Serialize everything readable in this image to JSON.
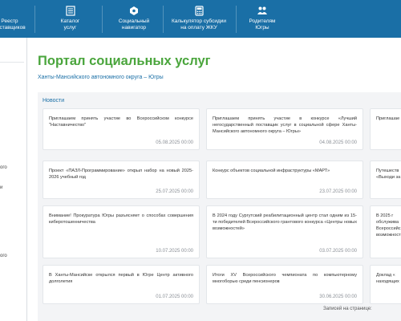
{
  "nav": {
    "items": [
      {
        "label": "Реестр\nпоставщиков",
        "icon": "list-icon"
      },
      {
        "label": "Каталог\nуслуг",
        "icon": "catalog-icon"
      },
      {
        "label": "Социальный\nнавигатор",
        "icon": "navigator-icon"
      },
      {
        "label": "Калькулятор субсидии\nна оплату ЖКУ",
        "icon": "calculator-icon"
      },
      {
        "label": "Родителям\nЮгры",
        "icon": "parents-icon"
      }
    ]
  },
  "sidebar": {
    "items": [
      "ого",
      "и",
      "ого"
    ]
  },
  "page": {
    "title": "Портал социальных услуг",
    "subtitle": "Ханты-Мансийского автономного округа – Югры"
  },
  "news": {
    "heading": "Новости",
    "cards": [
      {
        "text": "Приглашаем принять участие во Всероссийском конкурсе \"Наставничество\"",
        "date": "05.08.2025 00:00"
      },
      {
        "text": "Приглашаем принять участие в конкурсе «Лучший негосударственный поставщик услуг в социальной сфере Ханты-Мансийского автономного округа – Югры»",
        "date": "04.08.2025 00:00"
      },
      {
        "text": "Приглашае",
        "date": ""
      },
      {
        "text": "Проект «ПАЗЛ-Программирование» открыл набор на новый 2025-2026 учебный год",
        "date": "25.07.2025 00:00"
      },
      {
        "text": "Конкурс объектов социальной инфраструктуры «МАРТ»",
        "date": "23.07.2025 00:00"
      },
      {
        "text": "Путешеств «Выходи за",
        "date": ""
      },
      {
        "text": "Внимание! Прокуратура Югры разъясняет о способах совершения киберотошенничества",
        "date": "10.07.2025 00:00"
      },
      {
        "text": "В 2024 году Сургутский реабилитационный центр стал одним из 15-ти победителей Всероссийского грантового конкурса «Центры новых возможностей»",
        "date": "03.07.2025 00:00"
      },
      {
        "text": "В 2025 г обслужива Всероссийс возможност",
        "date": ""
      },
      {
        "text": "В Ханты-Мансийске открылся первый в Югре Центр активного долголетия",
        "date": "01.07.2025 00:00"
      },
      {
        "text": "Итоги XV Всероссийского чемпионата по компьютерному многоборью среди пенсионеров",
        "date": "30.06.2025 00:00"
      },
      {
        "text": "Доклад « находящих",
        "date": ""
      }
    ]
  },
  "footer": {
    "per_page_label": "Записей на странице:"
  },
  "colors": {
    "nav_bg": "#1a6fa6",
    "title_green": "#4aa53c",
    "link_blue": "#1a6fa6",
    "news_bg": "#f3f4f6"
  }
}
